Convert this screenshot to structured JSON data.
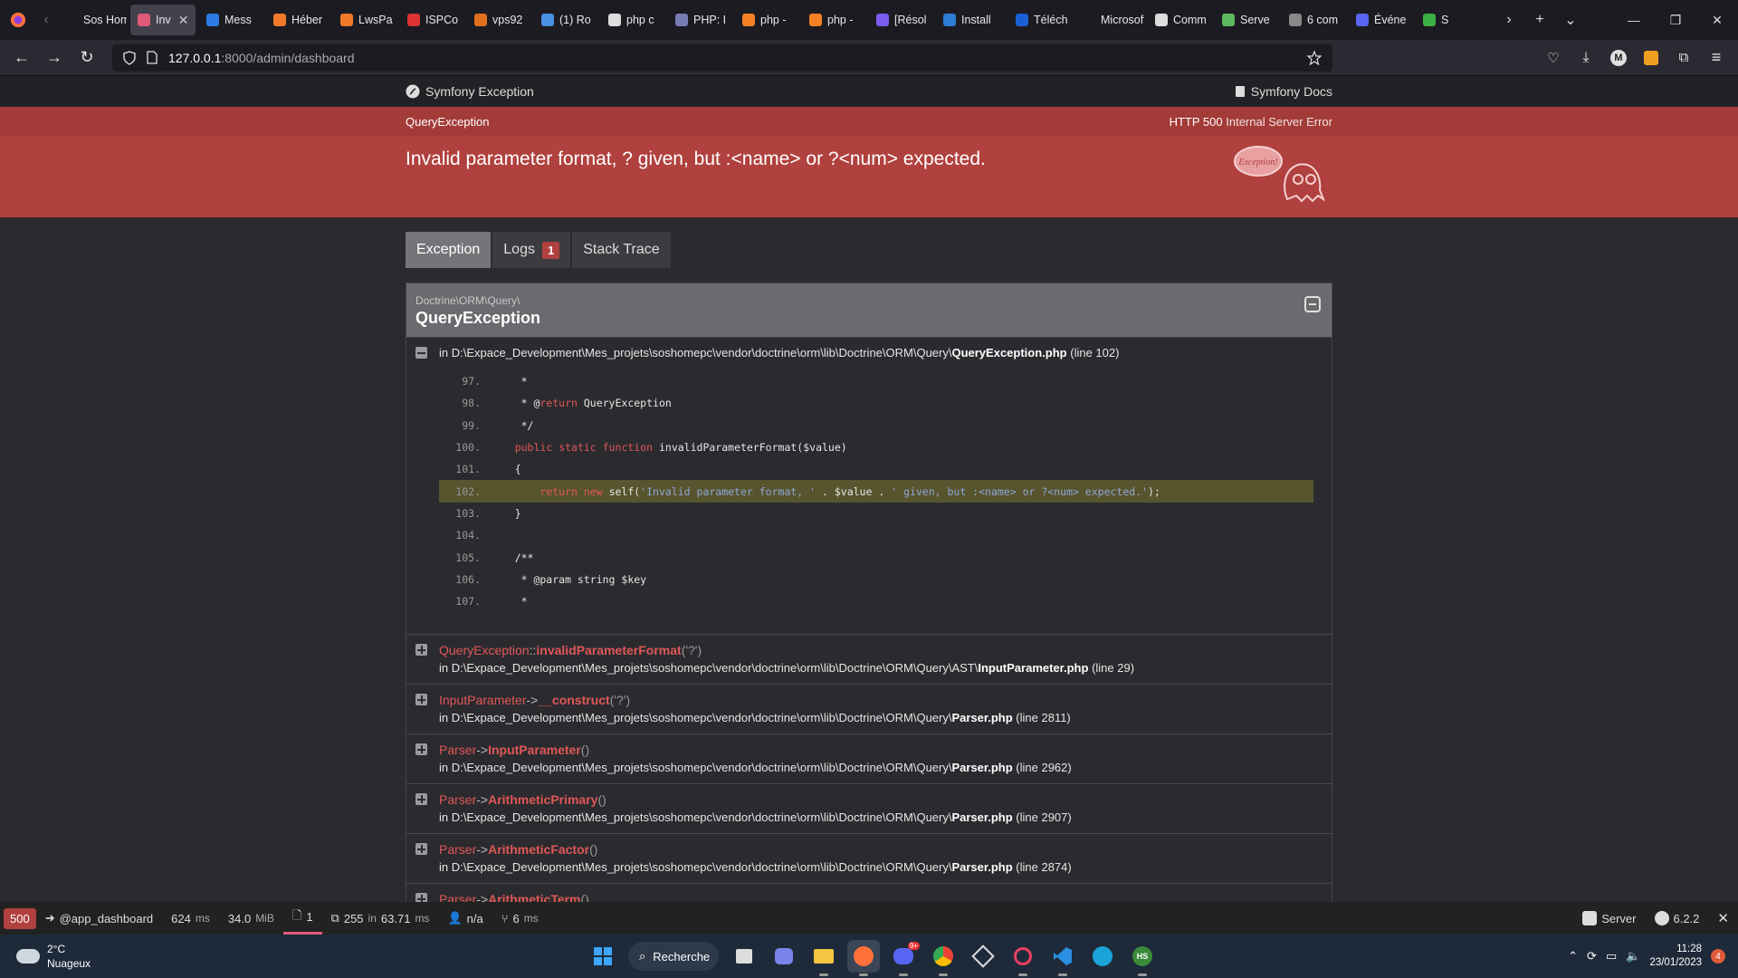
{
  "browser": {
    "tabs": [
      {
        "label": "Sos Home",
        "color": "#1c1b22"
      },
      {
        "label": "Inv",
        "color": "#e05a7a",
        "active": true
      },
      {
        "label": "Mess",
        "color": "#2c7be5"
      },
      {
        "label": "Héber",
        "color": "#f07a2a"
      },
      {
        "label": "LwsPa",
        "color": "#f07a2a"
      },
      {
        "label": "ISPCo",
        "color": "#d33"
      },
      {
        "label": "vps92",
        "color": "#e07020"
      },
      {
        "label": "(1) Ro",
        "color": "#4a90e2"
      },
      {
        "label": "php c",
        "color": "#ddd"
      },
      {
        "label": "PHP: I",
        "color": "#777bb3"
      },
      {
        "label": "php -",
        "color": "#f48024"
      },
      {
        "label": "php -",
        "color": "#f48024"
      },
      {
        "label": "[Résol",
        "color": "#7b5cf0"
      },
      {
        "label": "Install",
        "color": "#2e7bd6"
      },
      {
        "label": "Téléch",
        "color": "#1b5fd6"
      },
      {
        "label": "Microsoft",
        "color": "#1c1b22"
      },
      {
        "label": "Comm",
        "color": "#ddd"
      },
      {
        "label": "Serve",
        "color": "#5cb85c"
      },
      {
        "label": "6 com",
        "color": "#888"
      },
      {
        "label": "Événe",
        "color": "#5865f2"
      },
      {
        "label": "S",
        "color": "#3cb043"
      }
    ],
    "url_host": "127.0.0.1",
    "url_path": ":8000/admin/dashboard"
  },
  "symfony": {
    "brand": "Symfony Exception",
    "docs": "Symfony Docs",
    "exception_class": "QueryException",
    "http_status": "HTTP 500",
    "http_text": "Internal Server Error",
    "message": "Invalid parameter format, ? given, but :<name> or ?<num> expected.",
    "ghost_label": "Exception!",
    "tabs": [
      {
        "label": "Exception",
        "active": true
      },
      {
        "label": "Logs",
        "count": "1"
      },
      {
        "label": "Stack Trace"
      }
    ],
    "trace": {
      "namespace": "Doctrine\\ORM\\Query\\",
      "class": "QueryException",
      "first_file_prefix": "in D:\\Expace_Development\\Mes_projets\\soshomepc\\vendor\\doctrine\\orm\\lib\\Doctrine\\ORM\\Query\\",
      "first_file": "QueryException.php",
      "first_line": "(line 102)",
      "code": [
        {
          "n": "97.",
          "t": "     *"
        },
        {
          "n": "98.",
          "t": "     * @return QueryException"
        },
        {
          "n": "99.",
          "t": "     */"
        },
        {
          "n": "100.",
          "t": "    public static function invalidParameterFormat($value)"
        },
        {
          "n": "101.",
          "t": "    {"
        },
        {
          "n": "102.",
          "t": "        return new self('Invalid parameter format, ' . $value . ' given, but :<name> or ?<num> expected.');",
          "hl": true
        },
        {
          "n": "103.",
          "t": "    }"
        },
        {
          "n": "104.",
          "t": ""
        },
        {
          "n": "105.",
          "t": "    /**"
        },
        {
          "n": "106.",
          "t": "     * @param string $key"
        },
        {
          "n": "107.",
          "t": "     *"
        }
      ],
      "frames": [
        {
          "cls": "QueryException",
          "sep": "::",
          "method": "invalidParameterFormat",
          "args": "('?')",
          "path": "in D:\\Expace_Development\\Mes_projets\\soshomepc\\vendor\\doctrine\\orm\\lib\\Doctrine\\ORM\\Query\\AST\\",
          "file": "InputParameter.php",
          "line": "(line 29)"
        },
        {
          "cls": "InputParameter",
          "sep": "->",
          "method": "__construct",
          "args": "('?')",
          "path": "in D:\\Expace_Development\\Mes_projets\\soshomepc\\vendor\\doctrine\\orm\\lib\\Doctrine\\ORM\\Query\\",
          "file": "Parser.php",
          "line": "(line 2811)"
        },
        {
          "cls": "Parser",
          "sep": "->",
          "method": "InputParameter",
          "args": "()",
          "path": "in D:\\Expace_Development\\Mes_projets\\soshomepc\\vendor\\doctrine\\orm\\lib\\Doctrine\\ORM\\Query\\",
          "file": "Parser.php",
          "line": "(line 2962)"
        },
        {
          "cls": "Parser",
          "sep": "->",
          "method": "ArithmeticPrimary",
          "args": "()",
          "path": "in D:\\Expace_Development\\Mes_projets\\soshomepc\\vendor\\doctrine\\orm\\lib\\Doctrine\\ORM\\Query\\",
          "file": "Parser.php",
          "line": "(line 2907)"
        },
        {
          "cls": "Parser",
          "sep": "->",
          "method": "ArithmeticFactor",
          "args": "()",
          "path": "in D:\\Expace_Development\\Mes_projets\\soshomepc\\vendor\\doctrine\\orm\\lib\\Doctrine\\ORM\\Query\\",
          "file": "Parser.php",
          "line": "(line 2874)"
        },
        {
          "cls": "Parser",
          "sep": "->",
          "method": "ArithmeticTerm",
          "args": "()",
          "path": "",
          "file": "",
          "line": ""
        }
      ]
    }
  },
  "toolbar": {
    "status": "500",
    "route": "@app_dashboard",
    "time": "624",
    "time_unit": "ms",
    "memory": "34.0",
    "memory_unit": "MiB",
    "logs": "1",
    "db_queries": "255",
    "db_in": "in",
    "db_time": "63.71",
    "db_unit": "ms",
    "user": "n/a",
    "twig": "6",
    "twig_unit": "ms",
    "server": "Server",
    "version": "6.2.2"
  },
  "taskbar": {
    "weather_temp": "2°C",
    "weather_desc": "Nuageux",
    "search": "Recherche",
    "time": "11:28",
    "date": "23/01/2023",
    "notif": "4",
    "discord_badge": "9+"
  }
}
